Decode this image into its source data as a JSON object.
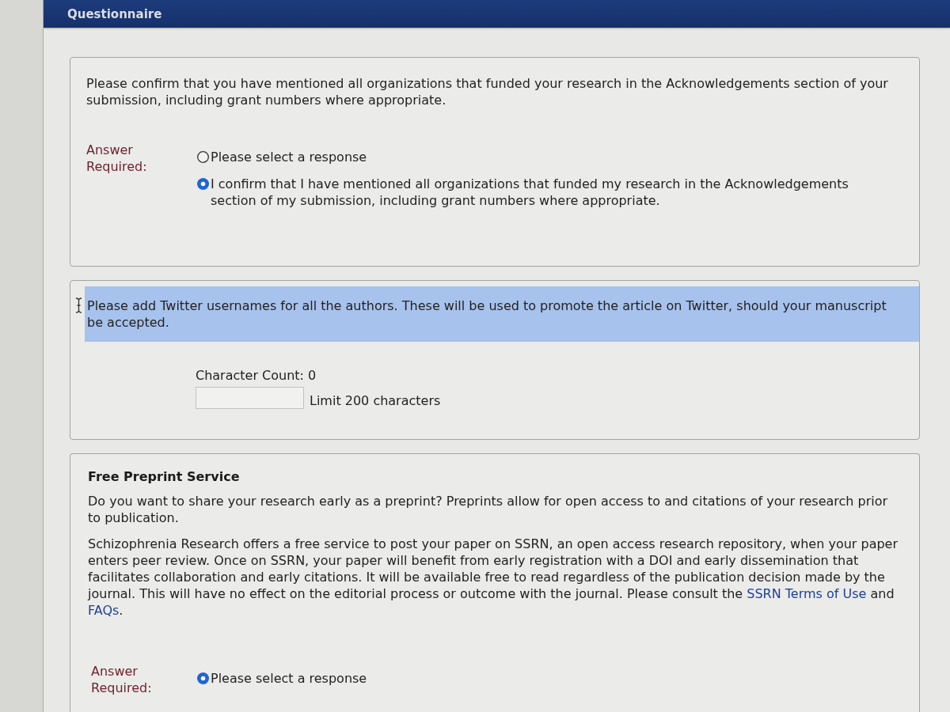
{
  "header": {
    "title": "Questionnaire"
  },
  "questions": [
    {
      "kind": "choice",
      "prompt": "Please confirm that you have mentioned all organizations that funded your research in the Acknowledgements section of your submission, including grant numbers where appropriate.",
      "answer_label": "Answer Required:",
      "options": [
        {
          "label": "Please select a response",
          "selected": false
        },
        {
          "label": "I confirm that I have mentioned all organizations that funded my research in the Acknowledgements section of my submission, including grant numbers where appropriate.",
          "selected": true
        }
      ]
    },
    {
      "kind": "text_entry",
      "highlighted": true,
      "prompt": "Please add Twitter usernames for all the authors. These will be used to promote the article on Twitter, should your manuscript be accepted.",
      "count_label": "Character Count: 0",
      "limit_label": "Limit 200 characters"
    },
    {
      "kind": "choice",
      "title": "Free Preprint Service",
      "paragraphs": [
        {
          "parts": [
            {
              "kind": "text",
              "text": "Do you want to share your research early as a preprint? Preprints allow for open access to and citations of your research prior to publication."
            }
          ]
        },
        {
          "parts": [
            {
              "kind": "text",
              "text": "Schizophrenia Research offers a free service to post your paper on SSRN, an open access research repository, when your paper enters peer review. Once on SSRN, your paper will benefit from early registration with a DOI and early dissemination that facilitates collaboration and early citations. It will be available free to read regardless of the publication decision made by the journal. This will have no effect on the editorial process or outcome with the journal. Please consult the "
            },
            {
              "kind": "link",
              "text": "SSRN Terms of Use"
            },
            {
              "kind": "text",
              "text": " and "
            },
            {
              "kind": "link",
              "text": "FAQs"
            },
            {
              "kind": "text",
              "text": "."
            }
          ]
        }
      ],
      "answer_label": "Answer Required:",
      "options": [
        {
          "label": "Please select a response",
          "selected": true
        }
      ]
    }
  ]
}
